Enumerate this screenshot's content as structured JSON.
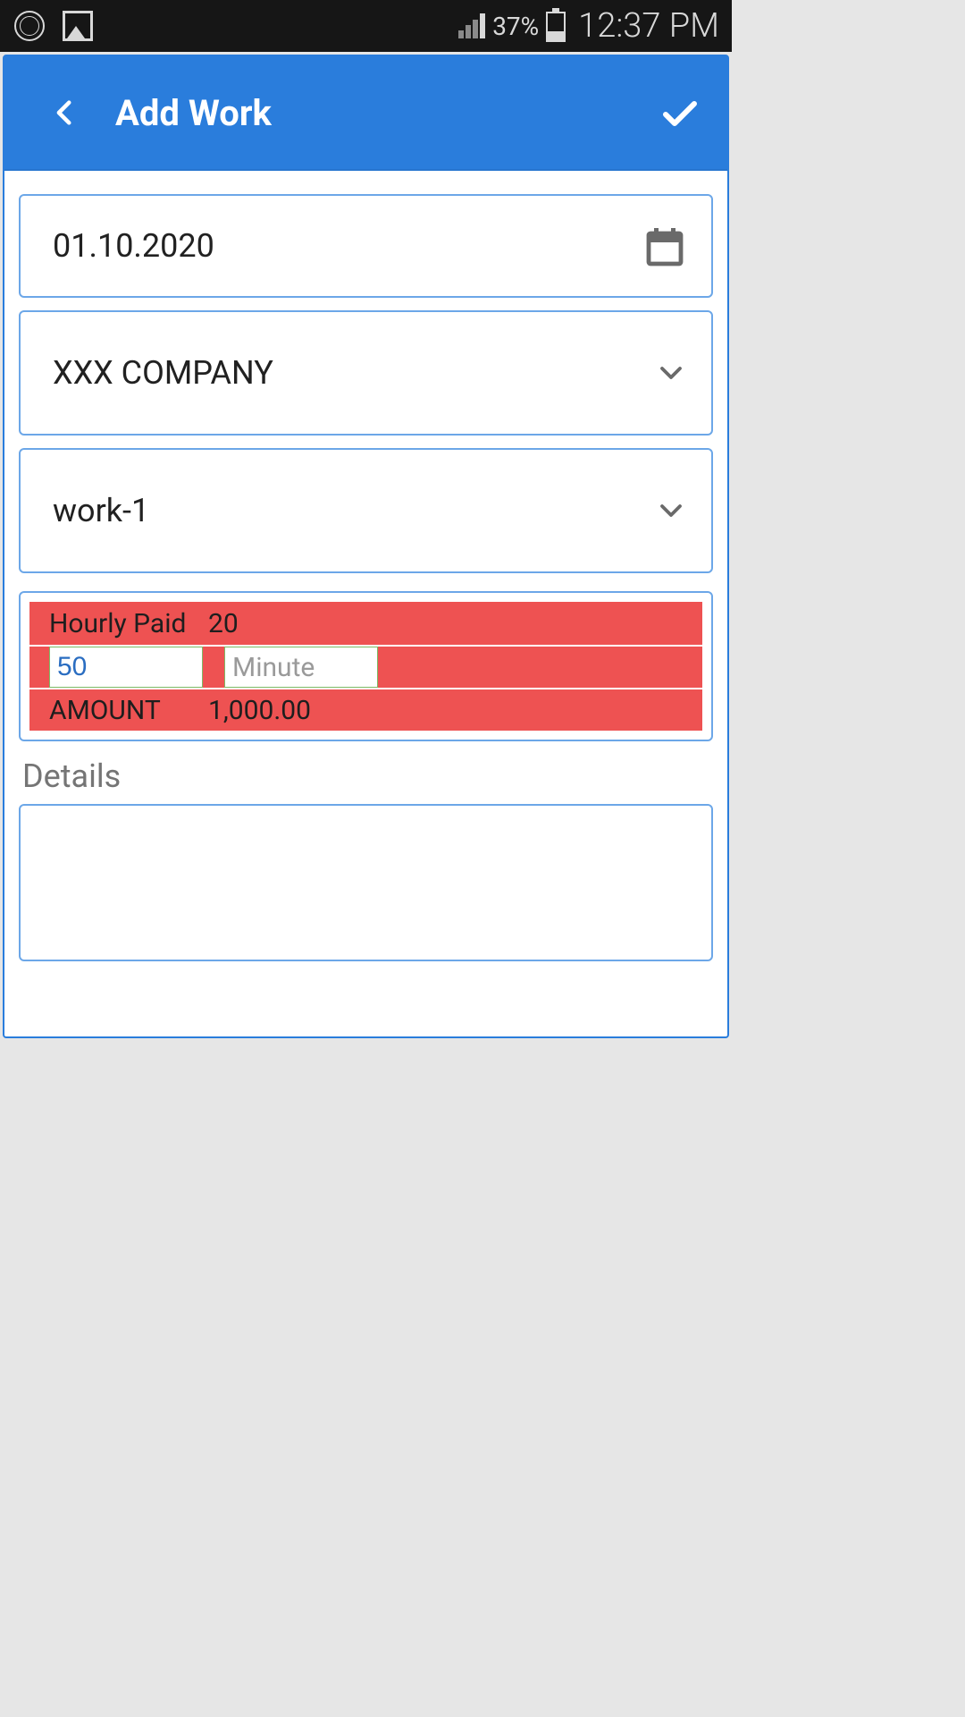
{
  "status": {
    "battery_pct": "37%",
    "time": "12:37 PM"
  },
  "header": {
    "title": "Add Work"
  },
  "form": {
    "date": "01.10.2020",
    "company": "XXX COMPANY",
    "work": "work-1",
    "calc": {
      "hourly_label": "Hourly Paid",
      "hourly_rate": "20",
      "hours_value": "50",
      "minute_placeholder": "Minute",
      "amount_label": "AMOUNT",
      "amount_value": "1,000.00"
    },
    "details_label": "Details",
    "details_value": ""
  }
}
